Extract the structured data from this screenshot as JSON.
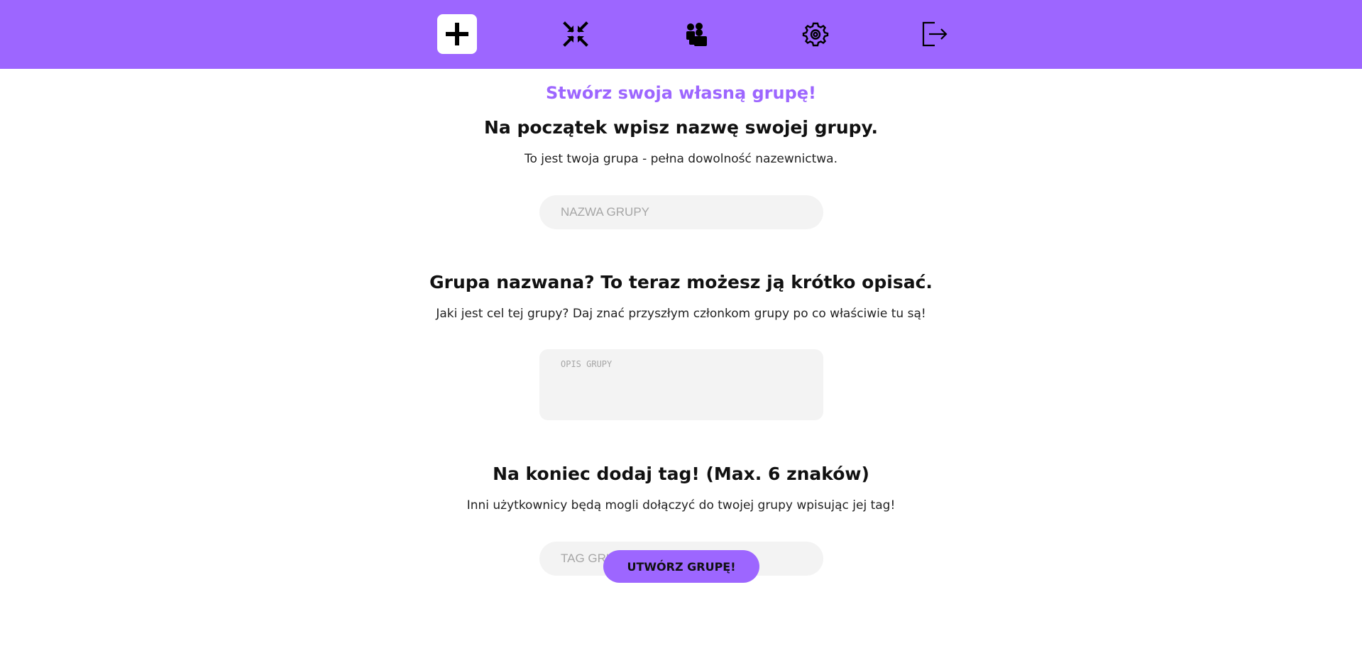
{
  "nav": {
    "items": [
      {
        "icon": "plus-icon",
        "active": true
      },
      {
        "icon": "compress-arrows-icon",
        "active": false
      },
      {
        "icon": "users-icon",
        "active": false
      },
      {
        "icon": "gear-icon",
        "active": false
      },
      {
        "icon": "logout-icon",
        "active": false
      }
    ]
  },
  "colors": {
    "accent": "#9d66ff",
    "field_bg": "#f3f3f3",
    "text": "#111111"
  },
  "page": {
    "title": "Stwórz swoja własną grupę!"
  },
  "sections": {
    "name": {
      "heading": "Na początek wpisz nazwę swojej grupy.",
      "description": "To jest twoja grupa - pełna dowolność nazewnictwa.",
      "placeholder": "NAZWA GRUPY",
      "value": ""
    },
    "description": {
      "heading": "Grupa nazwana? To teraz możesz ją krótko opisać.",
      "description": "Jaki jest cel tej grupy? Daj znać przyszłym członkom grupy po co właściwie tu są!",
      "placeholder": "OPIS GRUPY",
      "value": ""
    },
    "tag": {
      "heading": "Na koniec dodaj tag! (Max. 6 znaków)",
      "description": "Inni użytkownicy będą mogli dołączyć do twojej grupy wpisując jej tag!",
      "placeholder": "TAG GRUPY",
      "value": ""
    }
  },
  "submit": {
    "label": "UTWÓRZ GRUPĘ!"
  }
}
